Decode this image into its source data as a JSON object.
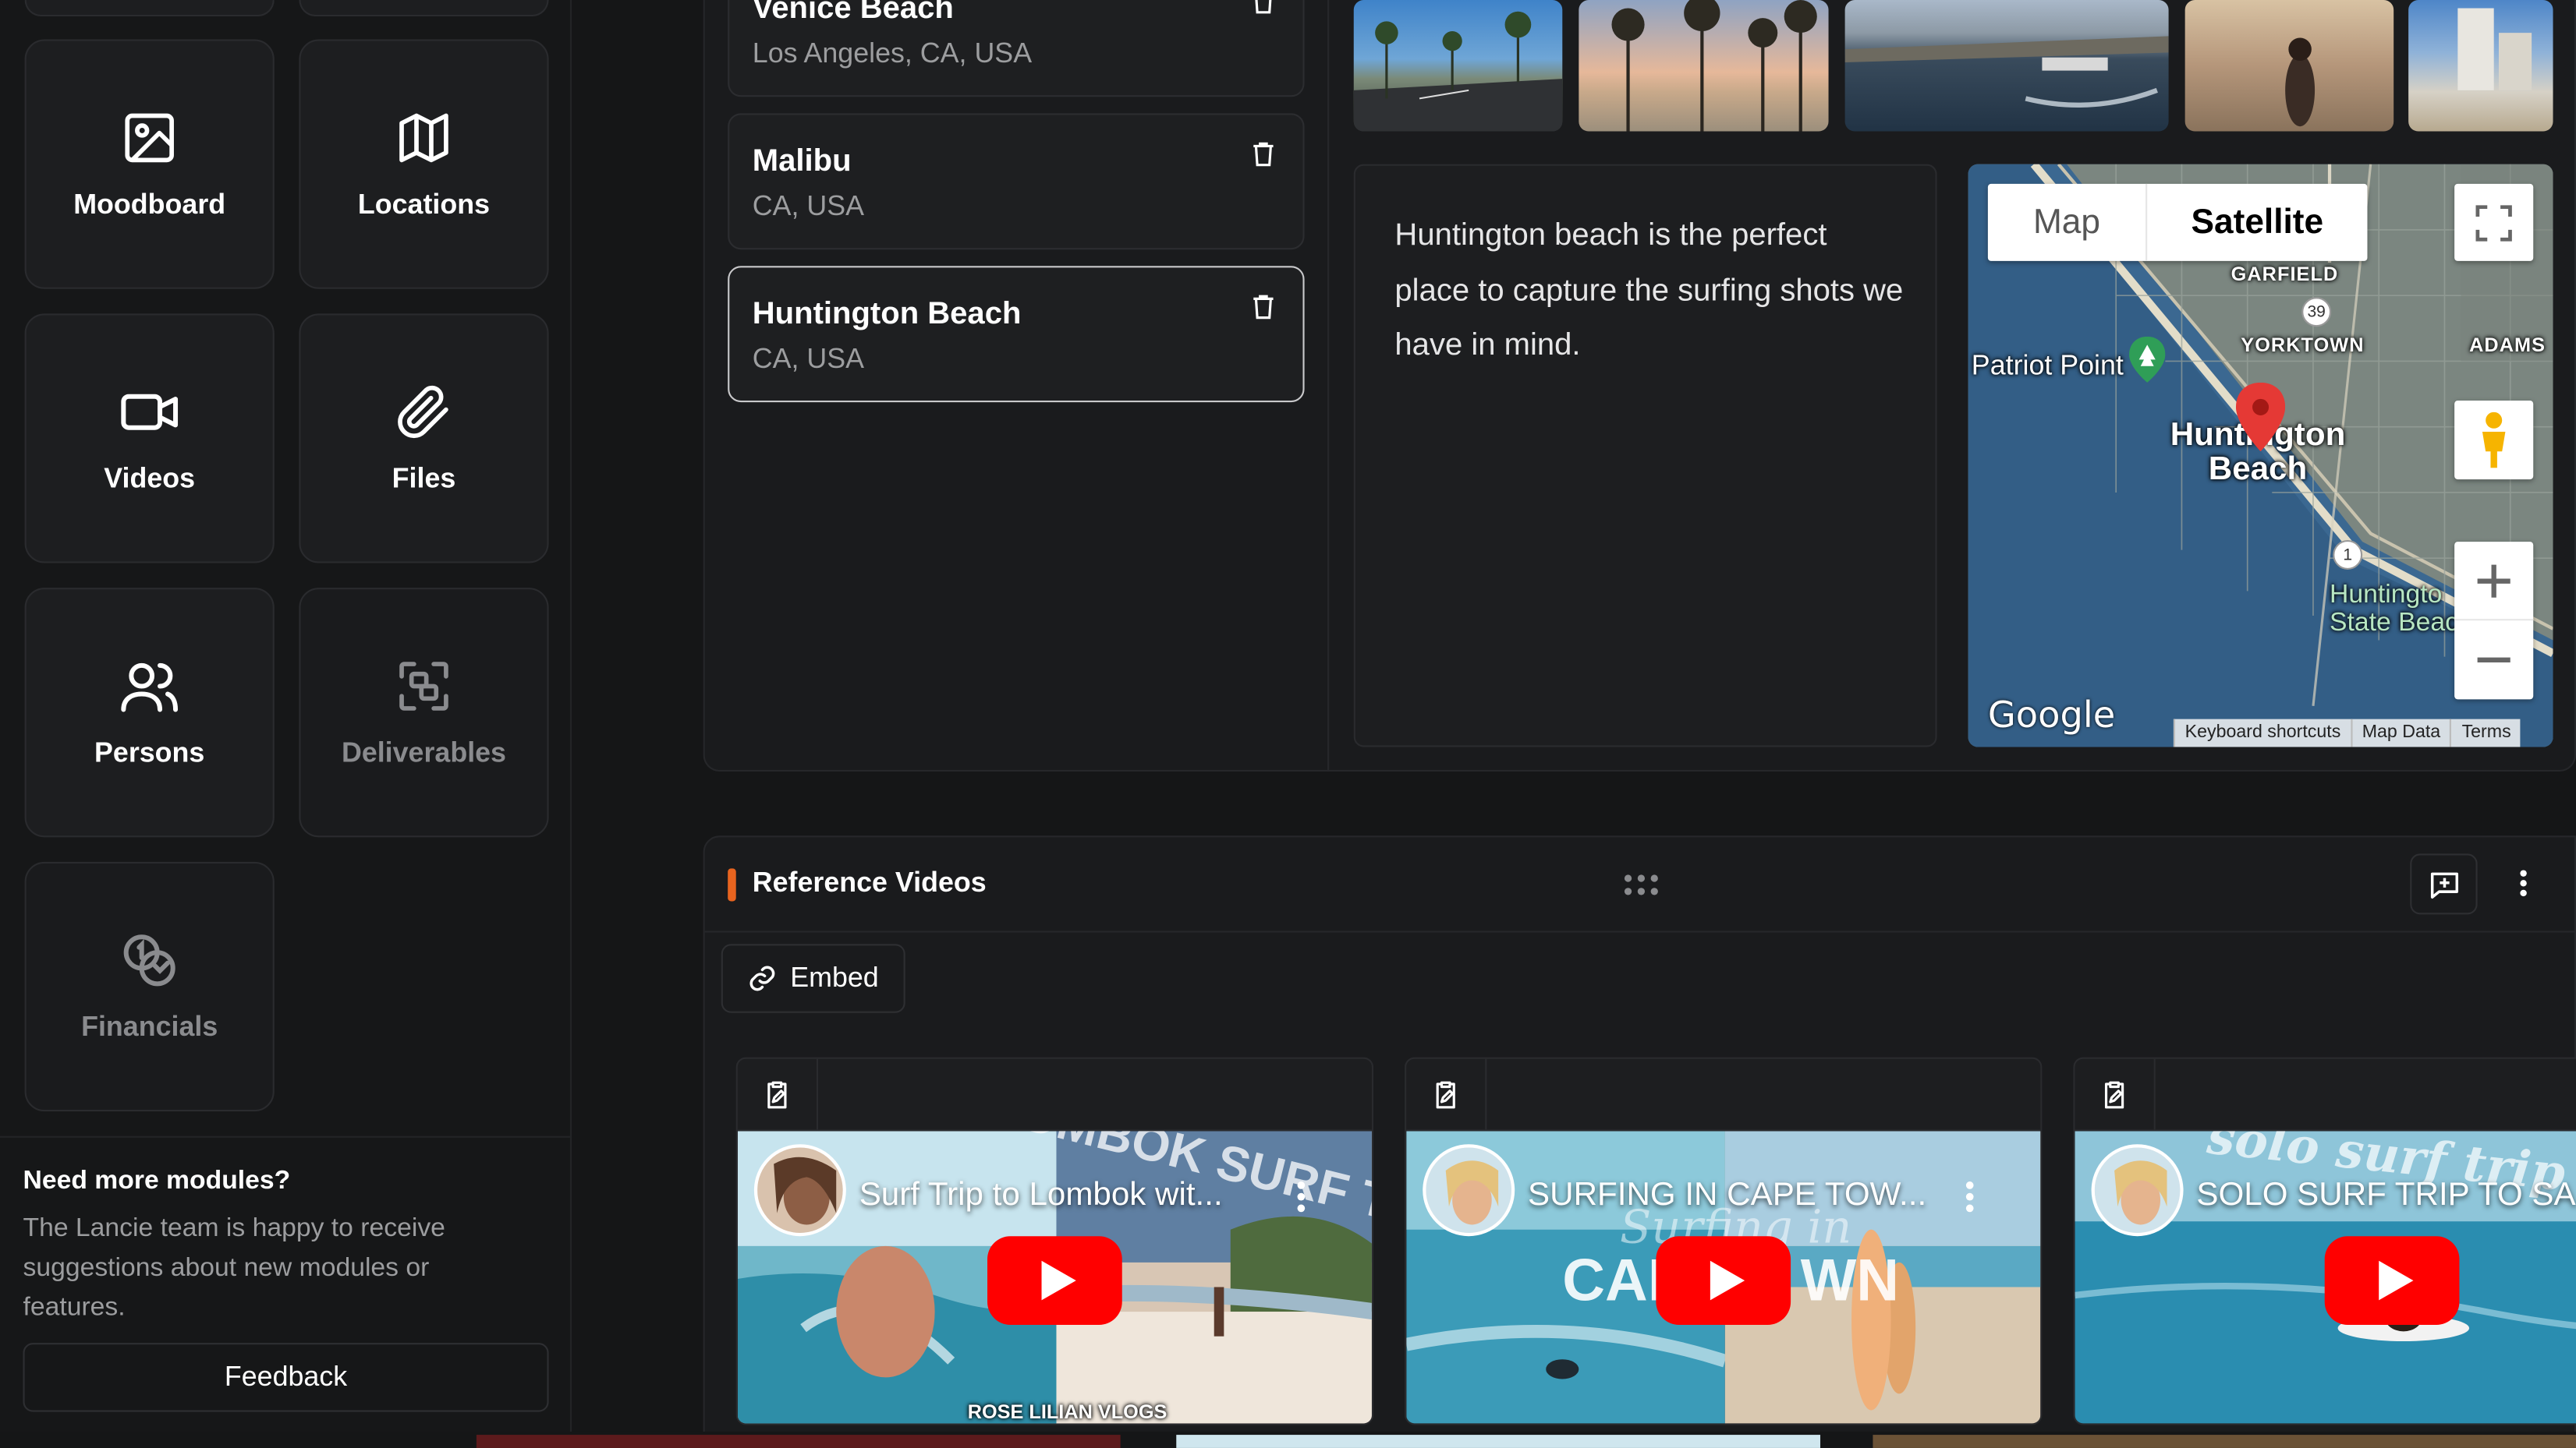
{
  "sidebar": {
    "modules": [
      {
        "label": "Moodboard",
        "icon": "image-icon",
        "enabled": true
      },
      {
        "label": "Locations",
        "icon": "map-icon",
        "enabled": true
      },
      {
        "label": "Videos",
        "icon": "video-camera-icon",
        "enabled": true
      },
      {
        "label": "Files",
        "icon": "paperclip-icon",
        "enabled": true
      },
      {
        "label": "Persons",
        "icon": "users-icon",
        "enabled": true
      },
      {
        "label": "Deliverables",
        "icon": "deliverables-icon",
        "enabled": false
      },
      {
        "label": "Financials",
        "icon": "coins-icon",
        "enabled": false
      }
    ],
    "promo": {
      "title": "Need more modules?",
      "text": "The Lancie team is happy to receive suggestions about new modules or features.",
      "button": "Feedback"
    }
  },
  "locations": {
    "items": [
      {
        "name": "Venice Beach",
        "region": "Los Angeles, CA, USA",
        "active": false
      },
      {
        "name": "Malibu",
        "region": "CA, USA",
        "active": false
      },
      {
        "name": "Huntington Beach",
        "region": "CA, USA",
        "active": true
      }
    ],
    "description": "Huntington beach is the perfect place to capture the surfing shots we have in mind.",
    "map": {
      "tab_map": "Map",
      "tab_satellite": "Satellite",
      "active_tab": "Satellite",
      "labels": {
        "garfield": "GARFIELD",
        "route39": "39",
        "yorktown": "YORKTOWN",
        "adams": "ADAMS",
        "patriot_point": "Patriot Point",
        "city_line1": "Huntington",
        "city_line2": "Beach",
        "route1": "1",
        "state_beach_line1": "Huntingto",
        "state_beach_line2": "State Beac"
      },
      "logo": "Google",
      "footer": [
        "Keyboard shortcuts",
        "Map Data",
        "Terms"
      ]
    }
  },
  "reference_videos": {
    "title": "Reference Videos",
    "embed_label": "Embed",
    "accent_color": "#e8641f",
    "videos": [
      {
        "title": "Surf Trip to Lombok wit...",
        "overlay": "LOMBOK SURF TRIP",
        "watermark": "ROSE LILIAN VLOGS"
      },
      {
        "title": "SURFING IN CAPE TOW...",
        "overlay_top": "Surfing in",
        "overlay_big_left": "CAP",
        "overlay_big_right": "WN"
      },
      {
        "title": "SOLO SURF TRIP TO SA...",
        "overlay": "solo surf trip to"
      }
    ]
  }
}
